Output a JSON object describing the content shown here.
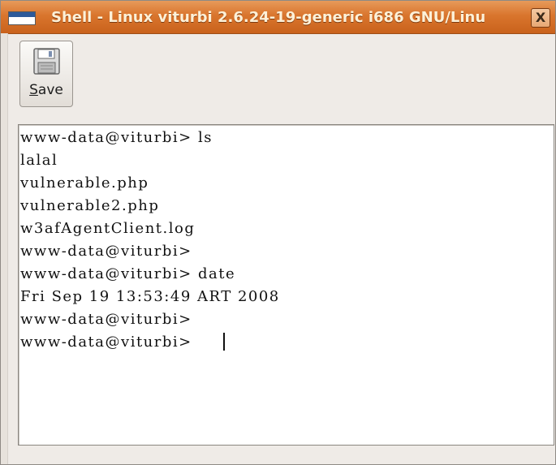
{
  "window": {
    "title": "Shell - Linux viturbi 2.6.24-19-generic i686 GNU/Linu",
    "close_glyph": "X"
  },
  "toolbar": {
    "save_mnemonic": "S",
    "save_rest": "ave"
  },
  "terminal": {
    "lines": [
      "www-data@viturbi> ls",
      "lalal",
      "vulnerable.php",
      "vulnerable2.php",
      "w3afAgentClient.log",
      "www-data@viturbi>",
      "www-data@viturbi> date",
      "Fri Sep 19 13:53:49 ART 2008",
      "www-data@viturbi>",
      "www-data@viturbi> "
    ]
  },
  "colors": {
    "titlebar": "#d9752d",
    "window_bg": "#efebe7",
    "terminal_bg": "#ffffff",
    "text": "#111111"
  },
  "icons": {
    "window_icon": "terminal-window-icon",
    "save_icon": "floppy-disk-icon",
    "close_icon": "close-icon"
  }
}
